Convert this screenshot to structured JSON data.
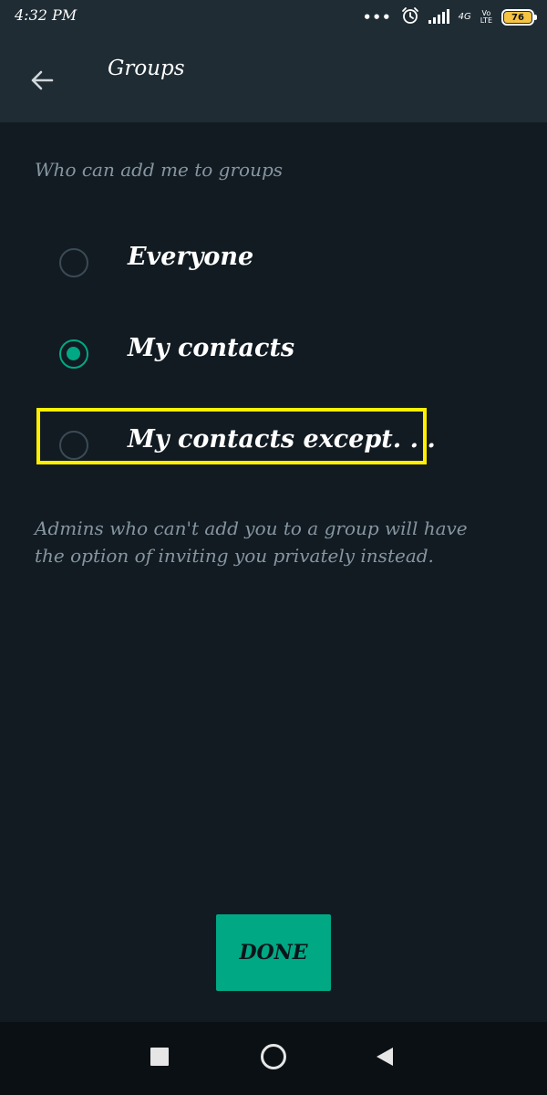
{
  "status_bar": {
    "time": "4:32 PM",
    "dots": "•••",
    "network": "4G",
    "volte_top": "Vo",
    "volte_bottom": "LTE",
    "battery": "76"
  },
  "app_bar": {
    "title": "Groups",
    "back_icon": "arrow-left-icon"
  },
  "section": {
    "label": "Who can add me to groups"
  },
  "options": [
    {
      "label": "Everyone",
      "selected": false
    },
    {
      "label": "My contacts",
      "selected": true
    },
    {
      "label": "My contacts except. . .",
      "selected": false,
      "highlighted": true
    }
  ],
  "info_note": "Admins who can't add you to a group will have the option of inviting you privately instead.",
  "done_button": {
    "label": "DONE"
  },
  "nav_bar": {
    "icons": [
      "square-recents-icon",
      "circle-home-icon",
      "triangle-back-icon"
    ]
  },
  "colors": {
    "background": "#121b22",
    "app_bar": "#1f2c34",
    "accent": "#00a884",
    "muted_text": "#8696a0",
    "highlight": "#ffef00",
    "battery": "#f6c343"
  }
}
